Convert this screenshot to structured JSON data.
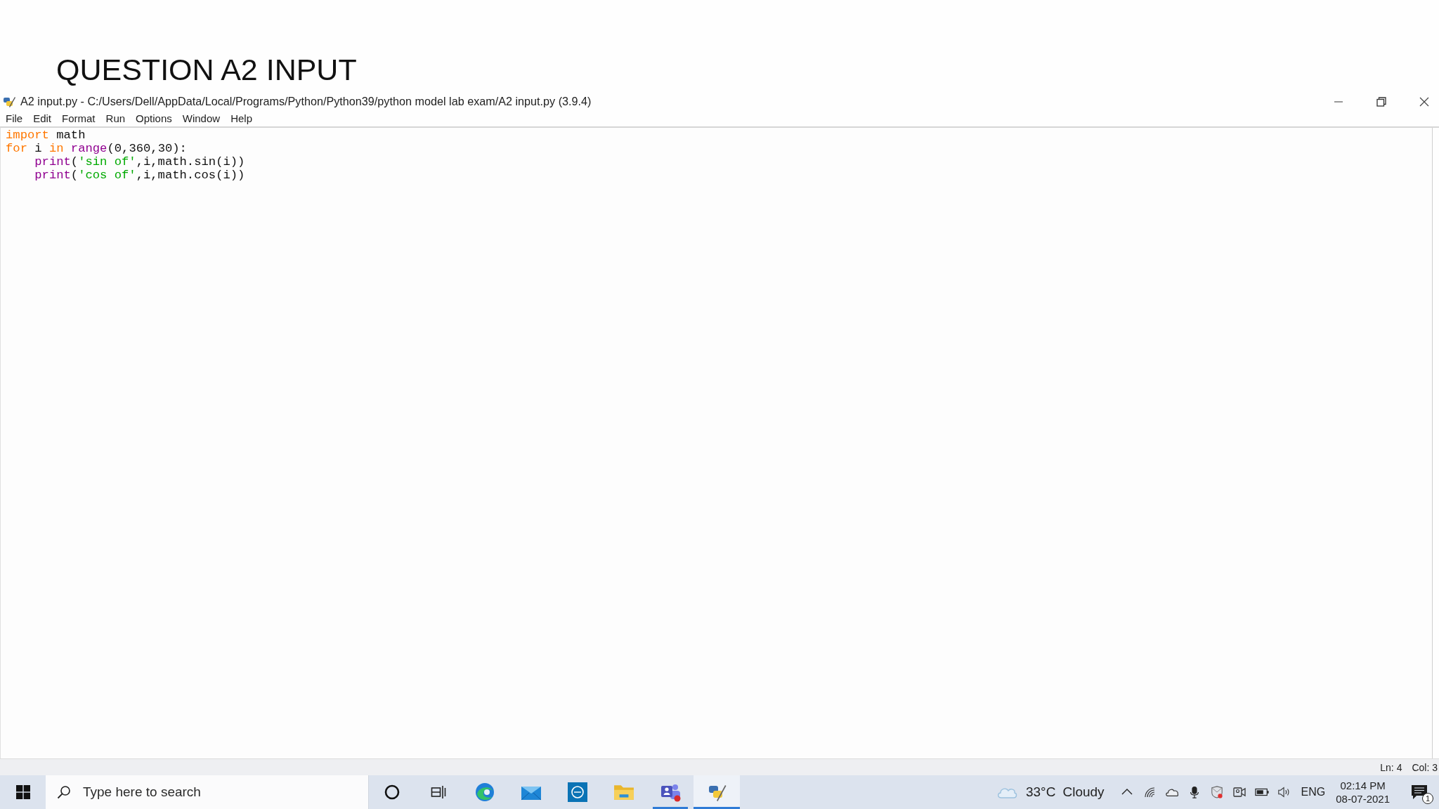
{
  "slide": {
    "title": "QUESTION A2 INPUT"
  },
  "window": {
    "title": "A2 input.py - C:/Users/Dell/AppData/Local/Programs/Python/Python39/python model lab exam/A2 input.py (3.9.4)"
  },
  "menu": [
    "File",
    "Edit",
    "Format",
    "Run",
    "Options",
    "Window",
    "Help"
  ],
  "editor": {
    "lines": [
      {
        "tokens": [
          {
            "kind": "keyword",
            "text": "import"
          },
          {
            "kind": "plain",
            "text": " math"
          }
        ]
      },
      {
        "tokens": [
          {
            "kind": "keyword",
            "text": "for"
          },
          {
            "kind": "plain",
            "text": " i "
          },
          {
            "kind": "keyword",
            "text": "in "
          },
          {
            "kind": "builtin",
            "text": "range"
          },
          {
            "kind": "plain",
            "text": "(0,360,30):"
          }
        ],
        "children": [
          {
            "tokens": [
              {
                "kind": "builtin",
                "text": "print"
              },
              {
                "kind": "plain",
                "text": "("
              },
              {
                "kind": "string",
                "text": "'sin of'"
              },
              {
                "kind": "plain",
                "text": ",i,math.sin(i))"
              }
            ]
          },
          {
            "tokens": [
              {
                "kind": "builtin",
                "text": "print"
              },
              {
                "kind": "plain",
                "text": "("
              },
              {
                "kind": "string",
                "text": "'cos of'"
              },
              {
                "kind": "plain",
                "text": ",i,math.cos(i))"
              }
            ]
          }
        ]
      }
    ]
  },
  "status_bar": {
    "line": "Ln: 4",
    "column": "Col: 3"
  },
  "taskbar": {
    "search": {
      "placeholder": "Type here to search"
    },
    "apps": [
      {
        "kind": "ring",
        "open": false,
        "selected": false
      },
      {
        "kind": "task-view",
        "open": false,
        "selected": false
      },
      {
        "kind": "swirl",
        "open": false,
        "selected": false
      },
      {
        "kind": "envelope",
        "open": false,
        "selected": false
      },
      {
        "kind": "logo-tile",
        "open": false,
        "selected": false
      },
      {
        "kind": "folder",
        "open": false,
        "selected": false
      },
      {
        "kind": "people-tile",
        "open": true,
        "selected": false
      },
      {
        "kind": "snake-pencil",
        "open": true,
        "selected": true
      }
    ],
    "weather": {
      "temperature": "33°C",
      "condition": "Cloudy"
    },
    "language": "ENG",
    "clock": {
      "time": "02:14 PM",
      "date": "08-07-2021"
    },
    "notifications": {
      "count": "1"
    }
  }
}
